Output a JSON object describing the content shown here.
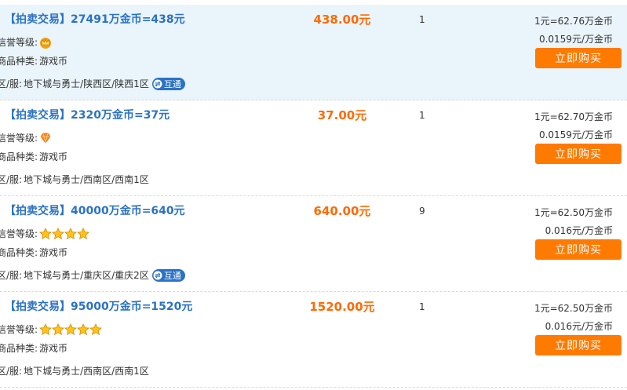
{
  "listings": [
    {
      "title": "【拍卖交易】27491万金币=438元",
      "level_label": "信誉等级:",
      "level_icon": "crown-icon",
      "category_label": "商品种类:",
      "category_value": "游戏币",
      "server_label": "区/服:",
      "server_value": "地下城与勇士/陕西区/陕西1区",
      "interop_badge": "互通",
      "price": "438.00元",
      "quantity": "1",
      "rate1": "1元=62.76万金币",
      "rate2": "0.0159元/万金币",
      "buy_label": "立即购买"
    },
    {
      "title": "【拍卖交易】2320万金币=37元",
      "level_label": "信誉等级:",
      "level_icon": "diamond-icon",
      "category_label": "商品种类:",
      "category_value": "游戏币",
      "server_label": "区/服:",
      "server_value": "地下城与勇士/西南区/西南1区",
      "price": "37.00元",
      "quantity": "1",
      "rate1": "1元=62.70万金币",
      "rate2": "0.0159元/万金币",
      "buy_label": "立即购买"
    },
    {
      "title": "【拍卖交易】40000万金币=640元",
      "level_label": "信誉等级:",
      "level_icon": "star-icon",
      "level_stars": 4,
      "category_label": "商品种类:",
      "category_value": "游戏币",
      "server_label": "区/服:",
      "server_value": "地下城与勇士/重庆区/重庆2区",
      "interop_badge": "互通",
      "price": "640.00元",
      "quantity": "9",
      "rate1": "1元=62.50万金币",
      "rate2": "0.016元/万金币",
      "buy_label": "立即购买"
    },
    {
      "title": "【拍卖交易】95000万金币=1520元",
      "level_label": "信誉等级:",
      "level_icon": "star-icon",
      "level_stars": 5,
      "category_label": "商品种类:",
      "category_value": "游戏币",
      "server_label": "区/服:",
      "server_value": "地下城与勇士/西南区/西南1区",
      "price": "1520.00元",
      "quantity": "1",
      "rate1": "1元=62.50万金币",
      "rate2": "0.016元/万金币",
      "buy_label": "立即购买"
    }
  ]
}
